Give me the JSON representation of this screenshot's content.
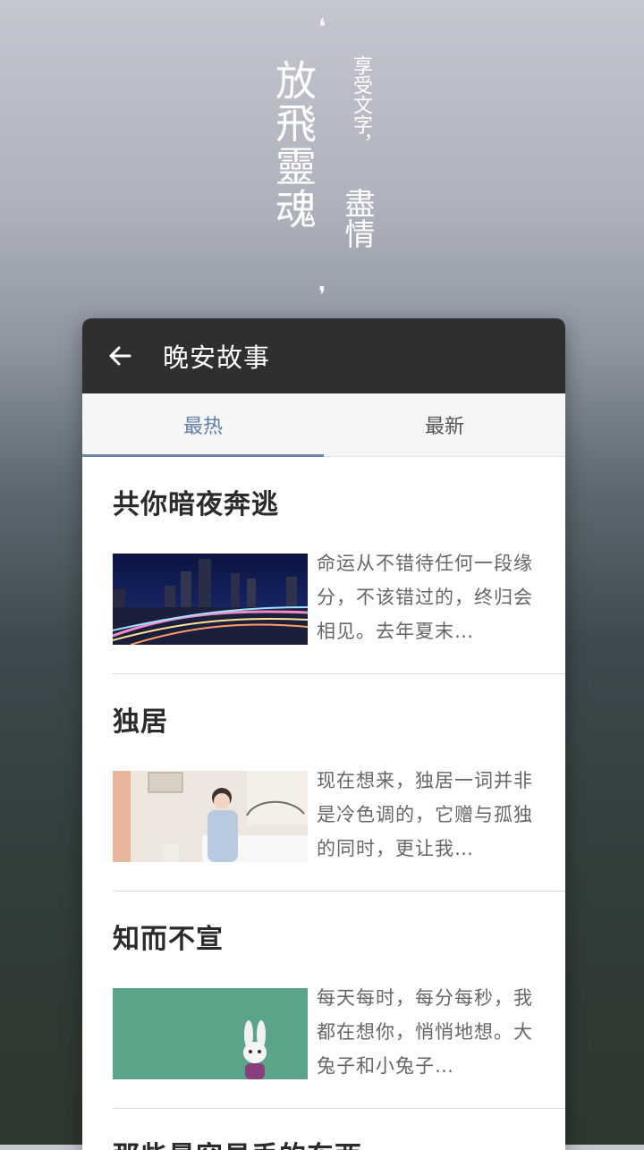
{
  "poster": {
    "main": "放飛靈魂",
    "sub": "享受文字，",
    "sub2": "盡情"
  },
  "appbar": {
    "title": "晚安故事"
  },
  "tabs": [
    {
      "label": "最热",
      "active": true
    },
    {
      "label": "最新",
      "active": false
    }
  ],
  "stories": [
    {
      "title": "共你暗夜奔逃",
      "excerpt": "命运从不错待任何一段缘分，不该错过的，终归会相见。去年夏末…"
    },
    {
      "title": "独居",
      "excerpt": "现在想来，独居一词并非是冷色调的，它赠与孤独的同时，更让我…"
    },
    {
      "title": "知而不宣",
      "excerpt": "每天每时，每分每秒，我都在想你，悄悄地想。大兔子和小兔子…"
    },
    {
      "title": "那些最容易丢的东西"
    }
  ],
  "colors": {
    "accent": "#6b86ad",
    "appbar": "#2f2f2f"
  }
}
